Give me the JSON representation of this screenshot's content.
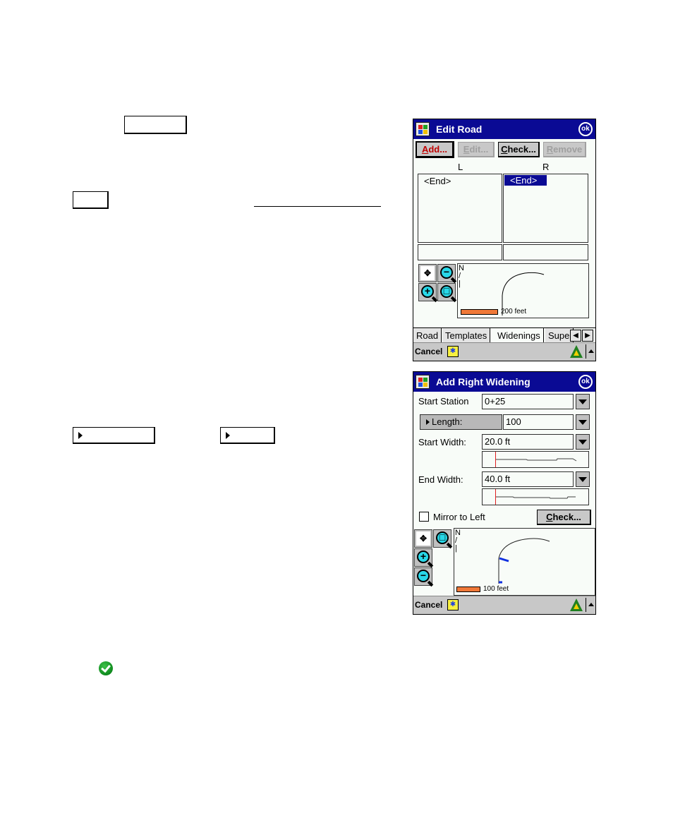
{
  "doc": {
    "check_icon": "green-check-icon"
  },
  "edit_road": {
    "title": "Edit Road",
    "ok_label": "ok",
    "buttons": [
      {
        "label": "Add...",
        "accel": "A",
        "rest": "dd...",
        "state": "default"
      },
      {
        "label": "Edit...",
        "accel": "E",
        "rest": "dit...",
        "state": "disabled"
      },
      {
        "label": "Check...",
        "accel": "C",
        "rest": "heck...",
        "state": "enabled"
      },
      {
        "label": "Remove",
        "accel": "R",
        "rest": "emove",
        "state": "disabled"
      }
    ],
    "left_header": "L",
    "right_header": "R",
    "left_list": [
      "<End>"
    ],
    "right_list": [
      "<End>"
    ],
    "right_selected": "<End>",
    "map": {
      "north_label": "N",
      "scale_label": "200 feet",
      "tools": [
        "zoom-extents",
        "zoom-out",
        "zoom-in",
        "zoom-window"
      ]
    },
    "tabs": [
      {
        "label": "Road",
        "active": false
      },
      {
        "label": "Templates",
        "active": false
      },
      {
        "label": "Widenings",
        "active": true
      },
      {
        "label": "Supe",
        "active": false
      }
    ],
    "tab_scroll": {
      "left": "◀",
      "right": "▶"
    },
    "cancel_label": "Cancel",
    "keyboard_glyph": "✱"
  },
  "add_widening": {
    "title": "Add Right Widening",
    "ok_label": "ok",
    "start_station_label": "Start Station",
    "start_station_value": "0+25",
    "length_label": "Length:",
    "length_value": "100",
    "start_width_label": "Start Width:",
    "start_width_value": "20.0 ft",
    "end_width_label": "End Width:",
    "end_width_value": "40.0 ft",
    "mirror_label": "Mirror to Left",
    "mirror_checked": false,
    "check_label": "Check...",
    "check_accel": "C",
    "check_rest": "heck...",
    "map": {
      "north_label": "N",
      "scale_label": "100 feet",
      "tools": [
        "zoom-extents",
        "zoom-window",
        "zoom-in",
        "zoom-out"
      ]
    },
    "cancel_label": "Cancel",
    "keyboard_glyph": "✱"
  }
}
